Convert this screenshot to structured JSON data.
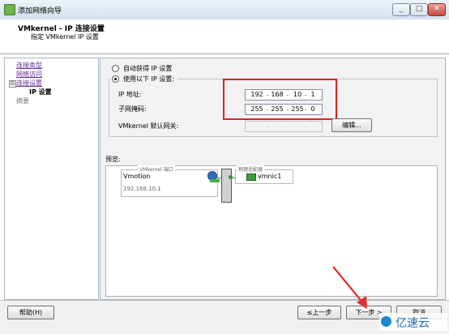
{
  "window": {
    "title": "添加网络向导",
    "controls": [
      "_",
      "□",
      "✕"
    ]
  },
  "header": {
    "title": "VMkernel - IP 连接设置",
    "subtitle": "指定 VMkernel IP 设置"
  },
  "nav": {
    "items": [
      {
        "label": "连接类型",
        "state": "link"
      },
      {
        "label": "网络访问",
        "state": "link"
      },
      {
        "label": "连接设置",
        "state": "link",
        "expander": "⊟"
      },
      {
        "label": "IP 设置",
        "state": "current"
      },
      {
        "label": "摘要",
        "state": "disabled"
      }
    ]
  },
  "ip_settings": {
    "auto_option": "自动获得 IP 设置",
    "manual_option": "使用以下 IP 设置:",
    "selected": "manual",
    "ip_label": "IP 地址:",
    "ip_octets": [
      "192",
      "168",
      "10",
      "1"
    ],
    "mask_label": "子网掩码:",
    "mask_octets": [
      "255",
      "255",
      "255",
      "0"
    ],
    "gateway_label": "VMkernel 默认网关:",
    "gateway_octets": [
      "",
      "",
      "",
      ""
    ],
    "edit_button": "编辑..."
  },
  "preview": {
    "label": "预览:",
    "vmkernel_group_title": "VMkernel 端口",
    "port_name": "Vmotion",
    "port_ip": "192.168.10.1",
    "adapter_group_title": "物理适配器",
    "adapter_name": "vmnic1"
  },
  "footer": {
    "help": "帮助(H)",
    "back": "≤上一步",
    "next": "下一步 >",
    "cancel": "取消"
  },
  "watermark": "亿速云",
  "colors": {
    "highlight_red": "#e02020",
    "nav_link": "#6a2a9a",
    "arrow_red": "#e03030"
  }
}
